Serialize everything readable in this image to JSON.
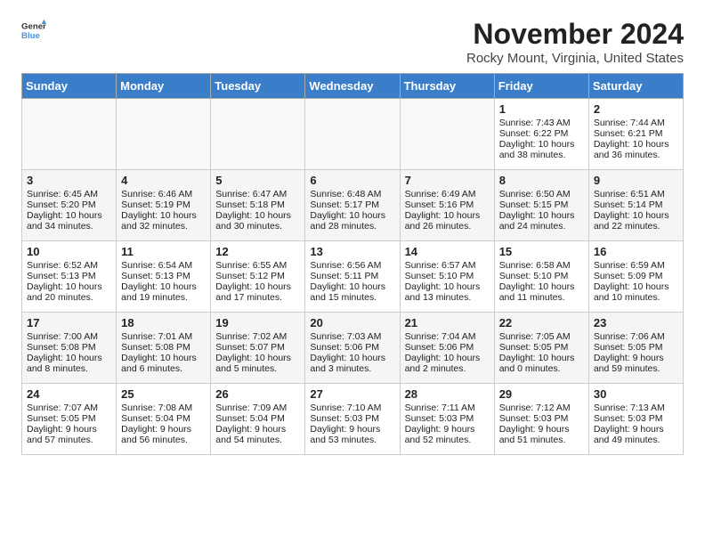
{
  "header": {
    "logo_general": "General",
    "logo_blue": "Blue",
    "month_year": "November 2024",
    "location": "Rocky Mount, Virginia, United States"
  },
  "days_of_week": [
    "Sunday",
    "Monday",
    "Tuesday",
    "Wednesday",
    "Thursday",
    "Friday",
    "Saturday"
  ],
  "weeks": [
    [
      {
        "day": "",
        "content": ""
      },
      {
        "day": "",
        "content": ""
      },
      {
        "day": "",
        "content": ""
      },
      {
        "day": "",
        "content": ""
      },
      {
        "day": "",
        "content": ""
      },
      {
        "day": "1",
        "content": "Sunrise: 7:43 AM\nSunset: 6:22 PM\nDaylight: 10 hours and 38 minutes."
      },
      {
        "day": "2",
        "content": "Sunrise: 7:44 AM\nSunset: 6:21 PM\nDaylight: 10 hours and 36 minutes."
      }
    ],
    [
      {
        "day": "3",
        "content": "Sunrise: 6:45 AM\nSunset: 5:20 PM\nDaylight: 10 hours and 34 minutes."
      },
      {
        "day": "4",
        "content": "Sunrise: 6:46 AM\nSunset: 5:19 PM\nDaylight: 10 hours and 32 minutes."
      },
      {
        "day": "5",
        "content": "Sunrise: 6:47 AM\nSunset: 5:18 PM\nDaylight: 10 hours and 30 minutes."
      },
      {
        "day": "6",
        "content": "Sunrise: 6:48 AM\nSunset: 5:17 PM\nDaylight: 10 hours and 28 minutes."
      },
      {
        "day": "7",
        "content": "Sunrise: 6:49 AM\nSunset: 5:16 PM\nDaylight: 10 hours and 26 minutes."
      },
      {
        "day": "8",
        "content": "Sunrise: 6:50 AM\nSunset: 5:15 PM\nDaylight: 10 hours and 24 minutes."
      },
      {
        "day": "9",
        "content": "Sunrise: 6:51 AM\nSunset: 5:14 PM\nDaylight: 10 hours and 22 minutes."
      }
    ],
    [
      {
        "day": "10",
        "content": "Sunrise: 6:52 AM\nSunset: 5:13 PM\nDaylight: 10 hours and 20 minutes."
      },
      {
        "day": "11",
        "content": "Sunrise: 6:54 AM\nSunset: 5:13 PM\nDaylight: 10 hours and 19 minutes."
      },
      {
        "day": "12",
        "content": "Sunrise: 6:55 AM\nSunset: 5:12 PM\nDaylight: 10 hours and 17 minutes."
      },
      {
        "day": "13",
        "content": "Sunrise: 6:56 AM\nSunset: 5:11 PM\nDaylight: 10 hours and 15 minutes."
      },
      {
        "day": "14",
        "content": "Sunrise: 6:57 AM\nSunset: 5:10 PM\nDaylight: 10 hours and 13 minutes."
      },
      {
        "day": "15",
        "content": "Sunrise: 6:58 AM\nSunset: 5:10 PM\nDaylight: 10 hours and 11 minutes."
      },
      {
        "day": "16",
        "content": "Sunrise: 6:59 AM\nSunset: 5:09 PM\nDaylight: 10 hours and 10 minutes."
      }
    ],
    [
      {
        "day": "17",
        "content": "Sunrise: 7:00 AM\nSunset: 5:08 PM\nDaylight: 10 hours and 8 minutes."
      },
      {
        "day": "18",
        "content": "Sunrise: 7:01 AM\nSunset: 5:08 PM\nDaylight: 10 hours and 6 minutes."
      },
      {
        "day": "19",
        "content": "Sunrise: 7:02 AM\nSunset: 5:07 PM\nDaylight: 10 hours and 5 minutes."
      },
      {
        "day": "20",
        "content": "Sunrise: 7:03 AM\nSunset: 5:06 PM\nDaylight: 10 hours and 3 minutes."
      },
      {
        "day": "21",
        "content": "Sunrise: 7:04 AM\nSunset: 5:06 PM\nDaylight: 10 hours and 2 minutes."
      },
      {
        "day": "22",
        "content": "Sunrise: 7:05 AM\nSunset: 5:05 PM\nDaylight: 10 hours and 0 minutes."
      },
      {
        "day": "23",
        "content": "Sunrise: 7:06 AM\nSunset: 5:05 PM\nDaylight: 9 hours and 59 minutes."
      }
    ],
    [
      {
        "day": "24",
        "content": "Sunrise: 7:07 AM\nSunset: 5:05 PM\nDaylight: 9 hours and 57 minutes."
      },
      {
        "day": "25",
        "content": "Sunrise: 7:08 AM\nSunset: 5:04 PM\nDaylight: 9 hours and 56 minutes."
      },
      {
        "day": "26",
        "content": "Sunrise: 7:09 AM\nSunset: 5:04 PM\nDaylight: 9 hours and 54 minutes."
      },
      {
        "day": "27",
        "content": "Sunrise: 7:10 AM\nSunset: 5:03 PM\nDaylight: 9 hours and 53 minutes."
      },
      {
        "day": "28",
        "content": "Sunrise: 7:11 AM\nSunset: 5:03 PM\nDaylight: 9 hours and 52 minutes."
      },
      {
        "day": "29",
        "content": "Sunrise: 7:12 AM\nSunset: 5:03 PM\nDaylight: 9 hours and 51 minutes."
      },
      {
        "day": "30",
        "content": "Sunrise: 7:13 AM\nSunset: 5:03 PM\nDaylight: 9 hours and 49 minutes."
      }
    ]
  ]
}
